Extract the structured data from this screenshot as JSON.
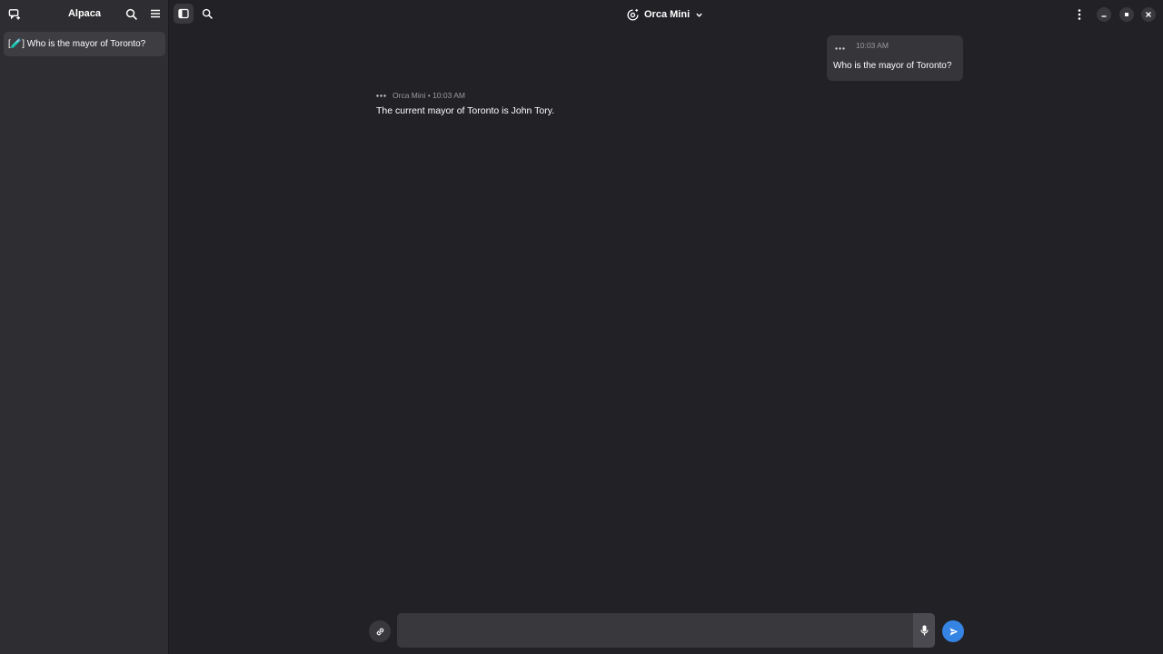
{
  "app": {
    "title": "Alpaca"
  },
  "sidebar": {
    "chats": [
      {
        "label": "[🧪] Who is the mayor of Toronto?"
      }
    ]
  },
  "header": {
    "model_name": "Orca Mini"
  },
  "messages": {
    "user": {
      "time": "10:03 AM",
      "text": "Who is the mayor of Toronto?"
    },
    "bot": {
      "meta": "Orca Mini • 10:03 AM",
      "text": "The current mayor of Toronto is John Tory."
    }
  },
  "input": {
    "value": "",
    "placeholder": ""
  },
  "colors": {
    "accent": "#3584e4",
    "background": "#222226",
    "sidebar": "#2e2e32"
  },
  "icons": {
    "new_chat": "new-chat-icon",
    "search": "search-icon",
    "menu": "hamburger-menu-icon",
    "sidebar_toggle": "sidebar-toggle-icon",
    "model_manager": "model-manager-icon",
    "more": "kebab-menu-icon"
  }
}
